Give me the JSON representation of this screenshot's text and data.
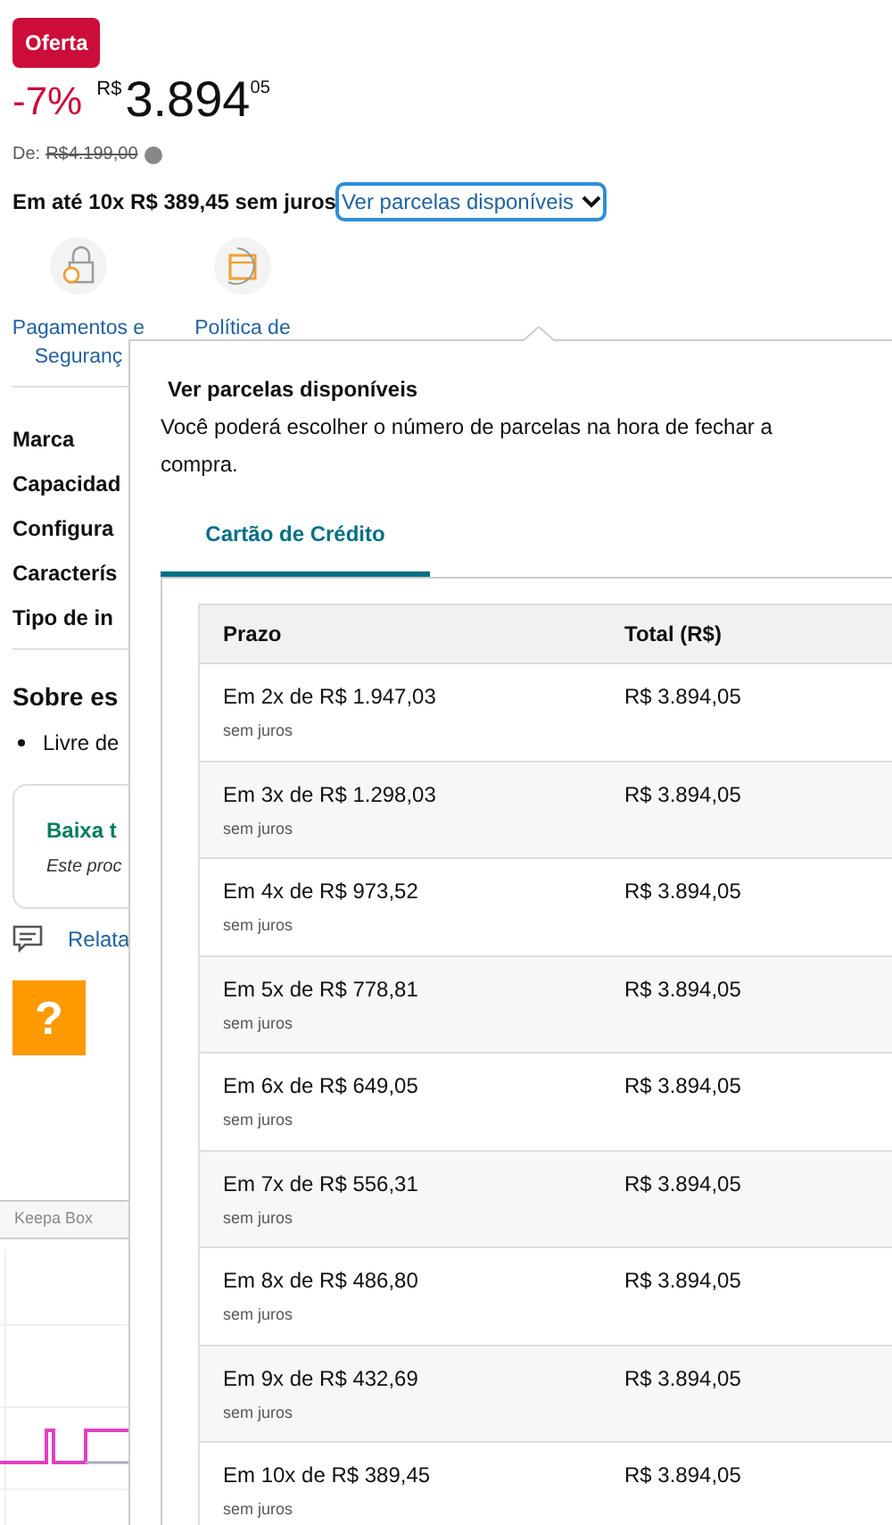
{
  "deal_badge": "Oferta",
  "price": {
    "discount": "-7%",
    "currency": "R$",
    "whole": "3.894",
    "cents": "05"
  },
  "list_price": {
    "label": "De:",
    "value": "R$4.199,00"
  },
  "installments": {
    "text": "Em até 10x R$ 389,45 sem juros",
    "link": "Ver parcelas disponíveis",
    "expanded": true
  },
  "features": [
    {
      "label_lines": [
        "Pagamentos e",
        "Seguranç"
      ]
    },
    {
      "label_lines": [
        "Política de"
      ]
    }
  ],
  "specs": [
    "Marca",
    "Capacidad",
    "Configura",
    "Caracterís",
    "Tipo de in"
  ],
  "about": {
    "heading": "Sobre es",
    "bullet": "Livre de"
  },
  "notice": {
    "title": "Baixa t",
    "text": "Este proc"
  },
  "report_link": "Relata",
  "help_button": "?",
  "keepa_label": "Keepa Box",
  "popover": {
    "title": "Ver parcelas disponíveis",
    "description": "Você poderá escolher o número de parcelas na hora de fechar a compra.",
    "tabs": [
      {
        "label": "Cartão de Crédito",
        "selected": true
      }
    ],
    "columns": [
      "Prazo",
      "Total (R$)"
    ],
    "rows": [
      {
        "term": "Em 2x de R$ 1.947,03",
        "note": "sem juros",
        "total": "R$ 3.894,05"
      },
      {
        "term": "Em 3x de R$ 1.298,03",
        "note": "sem juros",
        "total": "R$ 3.894,05"
      },
      {
        "term": "Em 4x de R$ 973,52",
        "note": "sem juros",
        "total": "R$ 3.894,05"
      },
      {
        "term": "Em 5x de R$ 778,81",
        "note": "sem juros",
        "total": "R$ 3.894,05"
      },
      {
        "term": "Em 6x de R$ 649,05",
        "note": "sem juros",
        "total": "R$ 3.894,05"
      },
      {
        "term": "Em 7x de R$ 556,31",
        "note": "sem juros",
        "total": "R$ 3.894,05"
      },
      {
        "term": "Em 8x de R$ 486,80",
        "note": "sem juros",
        "total": "R$ 3.894,05"
      },
      {
        "term": "Em 9x de R$ 432,69",
        "note": "sem juros",
        "total": "R$ 3.894,05"
      },
      {
        "term": "Em 10x de R$ 389,45",
        "note": "sem juros",
        "total": "R$ 3.894,05"
      }
    ]
  }
}
